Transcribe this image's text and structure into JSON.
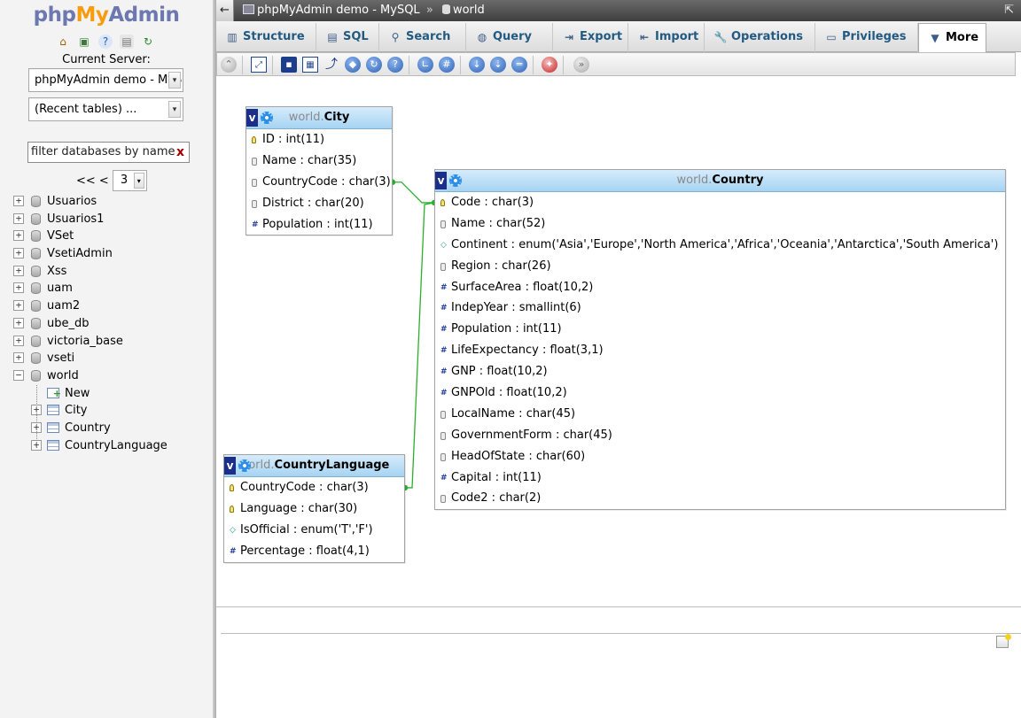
{
  "logo": {
    "php": "php",
    "my": "My",
    "admin": "Admin"
  },
  "nav": {
    "current_server_label": "Current Server:",
    "server_select": "phpMyAdmin demo - MySQL",
    "recent_select": "(Recent tables) ...",
    "filter_placeholder": "filter databases by name",
    "pager_prev": "<< <",
    "pager_page": "3",
    "databases": [
      "Usuarios",
      "Usuarios1",
      "VSet",
      "VsetiAdmin",
      "Xss",
      "uam",
      "uam2",
      "ube_db",
      "victoria_base",
      "vseti",
      "world"
    ],
    "world_children": [
      "New",
      "City",
      "Country",
      "CountryLanguage"
    ]
  },
  "topbar": {
    "server": "phpMyAdmin demo - MySQL",
    "separator": "»",
    "database": "world"
  },
  "tabs": [
    {
      "label": "Structure",
      "icon": "structure-icon"
    },
    {
      "label": "SQL",
      "icon": "sql-icon"
    },
    {
      "label": "Search",
      "icon": "search-icon"
    },
    {
      "label": "Query",
      "icon": "query-icon"
    },
    {
      "label": "Export",
      "icon": "export-icon"
    },
    {
      "label": "Import",
      "icon": "import-icon"
    },
    {
      "label": "Operations",
      "icon": "operations-icon"
    },
    {
      "label": "Privileges",
      "icon": "privileges-icon"
    },
    {
      "label": "More",
      "icon": "chevron-down-icon"
    }
  ],
  "designer": {
    "tables": [
      {
        "schema": "world.",
        "name": "City",
        "columns": [
          {
            "text": "ID : int(11)",
            "kind": "key"
          },
          {
            "text": "Name : char(35)",
            "kind": "text"
          },
          {
            "text": "CountryCode : char(3)",
            "kind": "text"
          },
          {
            "text": "District : char(20)",
            "kind": "text"
          },
          {
            "text": "Population : int(11)",
            "kind": "num"
          }
        ]
      },
      {
        "schema": "world.",
        "name": "Country",
        "columns": [
          {
            "text": "Code : char(3)",
            "kind": "key"
          },
          {
            "text": "Name : char(52)",
            "kind": "text"
          },
          {
            "text": "Continent : enum('Asia','Europe','North America','Africa','Oceania','Antarctica','South America')",
            "kind": "enum"
          },
          {
            "text": "Region : char(26)",
            "kind": "text"
          },
          {
            "text": "SurfaceArea : float(10,2)",
            "kind": "num"
          },
          {
            "text": "IndepYear : smallint(6)",
            "kind": "num"
          },
          {
            "text": "Population : int(11)",
            "kind": "num"
          },
          {
            "text": "LifeExpectancy : float(3,1)",
            "kind": "num"
          },
          {
            "text": "GNP : float(10,2)",
            "kind": "num"
          },
          {
            "text": "GNPOld : float(10,2)",
            "kind": "num"
          },
          {
            "text": "LocalName : char(45)",
            "kind": "text"
          },
          {
            "text": "GovernmentForm : char(45)",
            "kind": "text"
          },
          {
            "text": "HeadOfState : char(60)",
            "kind": "text"
          },
          {
            "text": "Capital : int(11)",
            "kind": "num"
          },
          {
            "text": "Code2 : char(2)",
            "kind": "text"
          }
        ]
      },
      {
        "schema": "world.",
        "name": "CountryLanguage",
        "columns": [
          {
            "text": "CountryCode : char(3)",
            "kind": "key"
          },
          {
            "text": "Language : char(30)",
            "kind": "key"
          },
          {
            "text": "IsOfficial : enum('T','F')",
            "kind": "enum"
          },
          {
            "text": "Percentage : float(4,1)",
            "kind": "num"
          }
        ]
      }
    ],
    "relation_color": "#2cb02c",
    "header_color": "#a6d3f2"
  }
}
